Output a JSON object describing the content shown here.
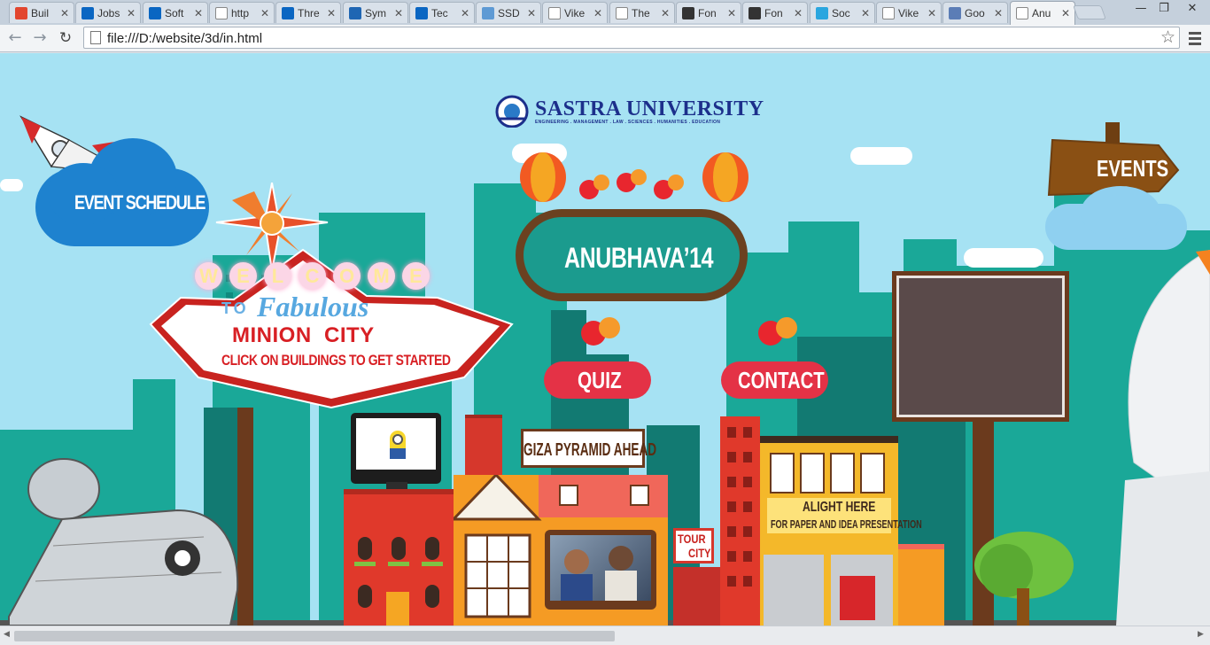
{
  "browser": {
    "tabs": [
      {
        "title": "Buil",
        "favicon": "orange-music-icon",
        "color": "#e2462f"
      },
      {
        "title": "Jobs",
        "favicon": "linkedin-icon",
        "color": "#0a66c2"
      },
      {
        "title": "Soft",
        "favicon": "linkedin-icon",
        "color": "#0a66c2"
      },
      {
        "title": "http",
        "favicon": "page-icon",
        "color": "#ffffff"
      },
      {
        "title": "Thre",
        "favicon": "linkedin-icon",
        "color": "#0a66c2"
      },
      {
        "title": "Sym",
        "favicon": "x-icon",
        "color": "#1f66b3"
      },
      {
        "title": "Tec",
        "favicon": "linkedin-icon",
        "color": "#0a66c2"
      },
      {
        "title": "SSD",
        "favicon": "cloud-icon",
        "color": "#5e9ad4"
      },
      {
        "title": "Vike",
        "favicon": "page-icon",
        "color": "#ffffff"
      },
      {
        "title": "The",
        "favicon": "page-icon",
        "color": "#ffffff"
      },
      {
        "title": "Fon",
        "favicon": "flag-icon",
        "color": "#333333"
      },
      {
        "title": "Fon",
        "favicon": "flag-icon",
        "color": "#333333"
      },
      {
        "title": "Soc",
        "favicon": "dots-icon",
        "color": "#2aa6df"
      },
      {
        "title": "Vike",
        "favicon": "page-icon",
        "color": "#ffffff"
      },
      {
        "title": "Goo",
        "favicon": "info-icon",
        "color": "#5b7db6"
      },
      {
        "title": "Anu",
        "favicon": "page-icon",
        "color": "#ffffff",
        "active": true
      }
    ],
    "close_glyph": "✕",
    "url": "file:///D:/website/3d/in.html",
    "back_glyph": "←",
    "forward_glyph": "→",
    "reload_glyph": "↻",
    "star_glyph": "☆",
    "minimize_glyph": "—",
    "restore_glyph": "❐",
    "close_window_glyph": "✕"
  },
  "page": {
    "logo": {
      "name": "SASTRA UNIVERSITY",
      "tagline": "ENGINEERING . MANAGEMENT . LAW . SCIENCES . HUMANITIES . EDUCATION"
    },
    "event_schedule_label": "EVENT SCHEDULE",
    "events_sign_label": "EVENTS",
    "festival_title": "ANUBHAVA’14",
    "quiz_label": "QUIZ",
    "contact_label": "CONTACT",
    "welcome_sign": {
      "welcome_letters": [
        "W",
        "E",
        "L",
        "C",
        "O",
        "M",
        "E"
      ],
      "to_label": "TO",
      "fabulous_label": "Fabulous",
      "city_label": "MINION  CITY",
      "instruction": "CLICK ON BUILDINGS TO GET STARTED"
    },
    "pyramid_sign": "GIZA PYRAMID AHEAD",
    "tour_city_sign": [
      "TOUR",
      "CITY"
    ],
    "alight_sign": {
      "title": "ALIGHT HERE",
      "subtitle": "FOR PAPER AND IDEA PRESENTATION"
    },
    "colors": {
      "sky": "#a6e2f3",
      "skyline": "#16a092",
      "pill_red": "#e43246",
      "oval_teal": "#1b9b8e",
      "oval_border": "#6b4120",
      "sign_red": "#d81f24",
      "events_brown": "#8a5014"
    }
  }
}
